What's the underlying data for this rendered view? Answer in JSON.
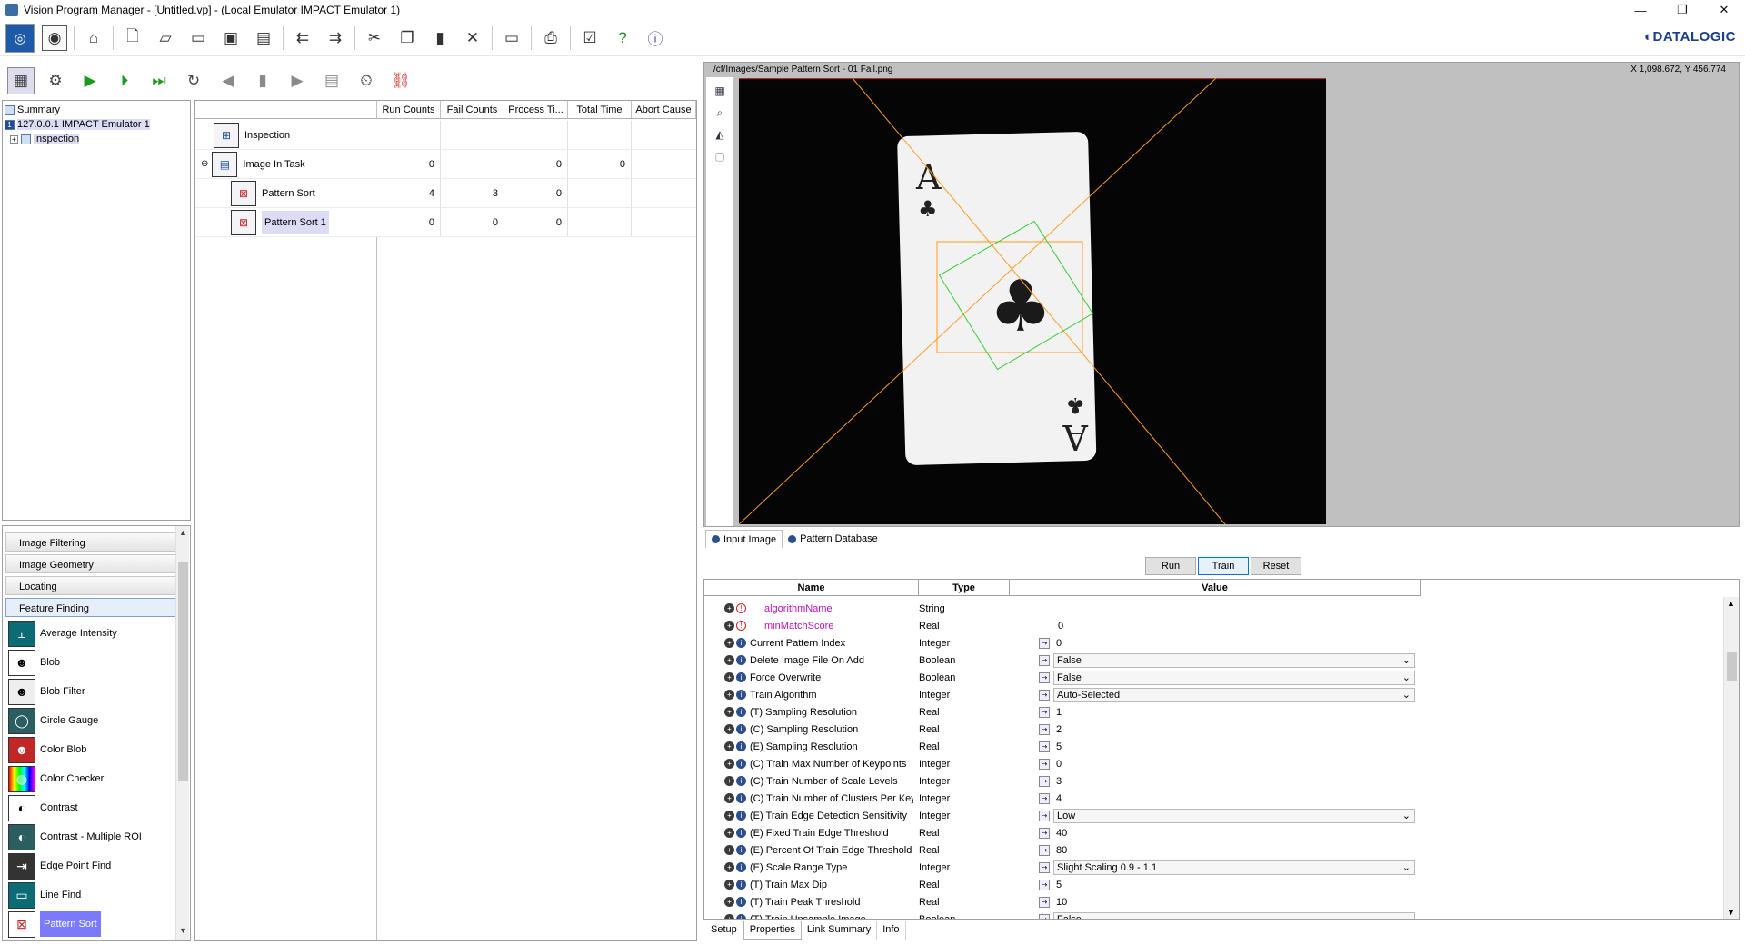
{
  "window": {
    "title": "Vision Program Manager - [Untitled.vp] - (Local Emulator IMPACT Emulator 1)",
    "minimize": "—",
    "restore": "❐",
    "close": "✕"
  },
  "brand": "◐DATALOGIC",
  "toolbar": {
    "icons": [
      "connect-icon",
      "stop-icon",
      "home-icon",
      "new-file-icon",
      "open-folder-icon",
      "folder-icon",
      "save-icon",
      "save-all-icon",
      "import-icon",
      "export-icon",
      "cut-icon",
      "copy-icon",
      "paste-icon",
      "delete-icon",
      "monitor-icon",
      "print-icon",
      "checklist-icon",
      "help-icon",
      "about-icon"
    ]
  },
  "toolbar2": {
    "icons": [
      "teach-icon",
      "settings-icon",
      "run-icon",
      "run-once-icon",
      "step-icon",
      "loop-icon",
      "prev-icon",
      "pause-icon",
      "next-icon",
      "record-icon",
      "counter-icon",
      "link-icon"
    ]
  },
  "tree": {
    "root": "Summary",
    "device": "127.0.0.1 IMPACT Emulator 1",
    "inspection": "Inspection",
    "expander": "+"
  },
  "palette": {
    "categories": [
      "Image Filtering",
      "Image Geometry",
      "Locating",
      "Feature Finding"
    ],
    "tools": [
      "Average Intensity",
      "Blob",
      "Blob Filter",
      "Circle Gauge",
      "Color Blob",
      "Color Checker",
      "Contrast",
      "Contrast - Multiple ROI",
      "Edge Point Find",
      "Line Find",
      "Pattern Sort"
    ]
  },
  "grid": {
    "headers": [
      "Run Counts",
      "Fail Counts",
      "Process Ti...",
      "Total Time",
      "Abort Cause"
    ],
    "rows": [
      {
        "name": "Inspection",
        "run": "",
        "fail": "",
        "proc": "",
        "total": ""
      },
      {
        "name": "Image In Task",
        "run": "0",
        "fail": "",
        "proc": "0",
        "total": "0"
      },
      {
        "name": "Pattern Sort",
        "run": "4",
        "fail": "3",
        "proc": "0",
        "total": ""
      },
      {
        "name": "Pattern Sort 1",
        "run": "0",
        "fail": "0",
        "proc": "0",
        "total": ""
      }
    ]
  },
  "image": {
    "path": "/cf/Images/Sample Pattern Sort - 01 Fail.png",
    "coord": "X 1,098.672,  Y 456.774",
    "card_rank": "A",
    "card_suit": "♣"
  },
  "image_tabs": [
    "Input Image",
    "Pattern Database"
  ],
  "actions": {
    "run": "Run",
    "train": "Train",
    "reset": "Reset"
  },
  "props": {
    "headers": {
      "name": "Name",
      "type": "Type",
      "value": "Value"
    },
    "rows": [
      {
        "name": "algorithmName",
        "type": "String",
        "value": "",
        "kind": "err"
      },
      {
        "name": "minMatchScore",
        "type": "Real",
        "value": "0",
        "kind": "err"
      },
      {
        "name": "Current Pattern Index",
        "type": "Integer",
        "value": "0",
        "kind": "plain"
      },
      {
        "name": "Delete Image File On Add",
        "type": "Boolean",
        "value": "False",
        "kind": "dd"
      },
      {
        "name": "Force Overwrite",
        "type": "Boolean",
        "value": "False",
        "kind": "dd"
      },
      {
        "name": "Train Algorithm",
        "type": "Integer",
        "value": "Auto-Selected",
        "kind": "dd"
      },
      {
        "name": "(T) Sampling Resolution",
        "type": "Real",
        "value": "1",
        "kind": "plain"
      },
      {
        "name": "(C) Sampling Resolution",
        "type": "Real",
        "value": "2",
        "kind": "plain"
      },
      {
        "name": "(E) Sampling Resolution",
        "type": "Real",
        "value": "5",
        "kind": "plain"
      },
      {
        "name": "(C) Train Max Number of Keypoints",
        "type": "Integer",
        "value": "0",
        "kind": "plain"
      },
      {
        "name": "(C) Train Number of Scale Levels",
        "type": "Integer",
        "value": "3",
        "kind": "plain"
      },
      {
        "name": "(C) Train Number of Clusters Per Key",
        "type": "Integer",
        "value": "4",
        "kind": "plain"
      },
      {
        "name": "(E) Train Edge Detection Sensitivity",
        "type": "Integer",
        "value": "Low",
        "kind": "dd"
      },
      {
        "name": "(E) Fixed Train Edge Threshold",
        "type": "Real",
        "value": "40",
        "kind": "plain"
      },
      {
        "name": "(E) Percent Of Train Edge Threshold",
        "type": "Real",
        "value": "80",
        "kind": "plain"
      },
      {
        "name": "(E) Scale Range Type",
        "type": "Integer",
        "value": "Slight Scaling 0.9 - 1.1",
        "kind": "dd"
      },
      {
        "name": "(T) Train Max Dip",
        "type": "Real",
        "value": "5",
        "kind": "plain"
      },
      {
        "name": "(T) Train Peak Threshold",
        "type": "Real",
        "value": "10",
        "kind": "plain"
      },
      {
        "name": "(T) Train Upsample Image",
        "type": "Boolean",
        "value": "False",
        "kind": "dd"
      }
    ]
  },
  "bottom_tabs": [
    "Setup",
    "Properties",
    "Link Summary",
    "Info"
  ]
}
